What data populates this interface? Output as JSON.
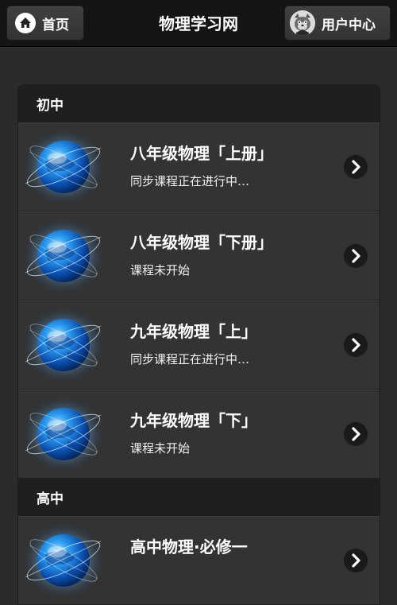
{
  "header": {
    "home_label": "首页",
    "title": "物理学习网",
    "user_label": "用户中心"
  },
  "sections": [
    {
      "label": "初中",
      "items": [
        {
          "title": "八年级物理「上册」",
          "subtitle": "同步课程正在进行中…"
        },
        {
          "title": "八年级物理「下册」",
          "subtitle": "课程未开始"
        },
        {
          "title": "九年级物理「上」",
          "subtitle": "同步课程正在进行中…"
        },
        {
          "title": "九年级物理「下」",
          "subtitle": "课程未开始"
        }
      ]
    },
    {
      "label": "高中",
      "items": [
        {
          "title": "高中物理·必修一",
          "subtitle": ""
        }
      ]
    }
  ],
  "icons": {
    "home": "home-icon",
    "avatar": "avatar-icon",
    "globe": "globe-icon",
    "arrow": "chevron-right-icon"
  },
  "colors": {
    "background": "#2b2b2b",
    "header": "#141414",
    "divider": "#1f1f1f",
    "item": "#333333"
  }
}
